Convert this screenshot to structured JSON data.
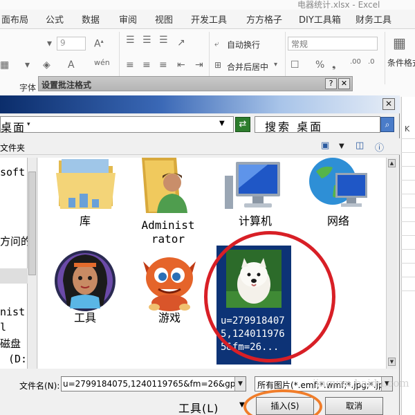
{
  "excel": {
    "window_title": "电器统计.xlsx - Excel",
    "tabs": [
      "面布局",
      "公式",
      "数据",
      "审阅",
      "视图",
      "开发工具",
      "方方格子",
      "DIY工具箱",
      "财务工具"
    ],
    "font_size": "9",
    "wrap_text": "自动换行",
    "merge_center": "合并后居中",
    "number_format": "常规",
    "font_group_label": "字体",
    "conditional_format": "条件格式",
    "column_k": "K"
  },
  "back_dialog": {
    "title": "设置批注格式"
  },
  "file_dialog": {
    "address": "桌面",
    "search_placeholder": "搜索 桌面",
    "new_folder": "文件夹",
    "nav_items": [
      "soft",
      "方问的",
      "nist",
      "l",
      "磁盘",
      "(D:"
    ],
    "files": [
      {
        "name": "库",
        "icon": "library-folder-icon"
      },
      {
        "name": "Administrator",
        "name_lines": [
          "Administ",
          "rator"
        ],
        "icon": "user-folder-icon"
      },
      {
        "name": "计算机",
        "icon": "computer-icon"
      },
      {
        "name": "网络",
        "icon": "network-icon"
      },
      {
        "name": "工具",
        "icon": "princess-avatar-icon"
      },
      {
        "name": "游戏",
        "icon": "orange-dragon-icon"
      }
    ],
    "selected_file": {
      "label": "u=2799184075,1240119765&fm=26...",
      "icon": "dog-photo-thumbnail"
    },
    "filename_label": "文件名(N):",
    "filename_value": "u=2799184075,1240119765&fm=26&gp=",
    "filetype_value": "所有图片(*.emf;*.wmf;*.jpg;*.jp",
    "tools_label": "工具(L)",
    "insert_label": "插入(S)",
    "cancel_label": "取消",
    "watermark": "jingyan.baidu.com"
  },
  "colors": {
    "selection_blue": "#0d3376",
    "red_annotation": "#d81f26",
    "orange_annotation": "#f07d2a"
  }
}
